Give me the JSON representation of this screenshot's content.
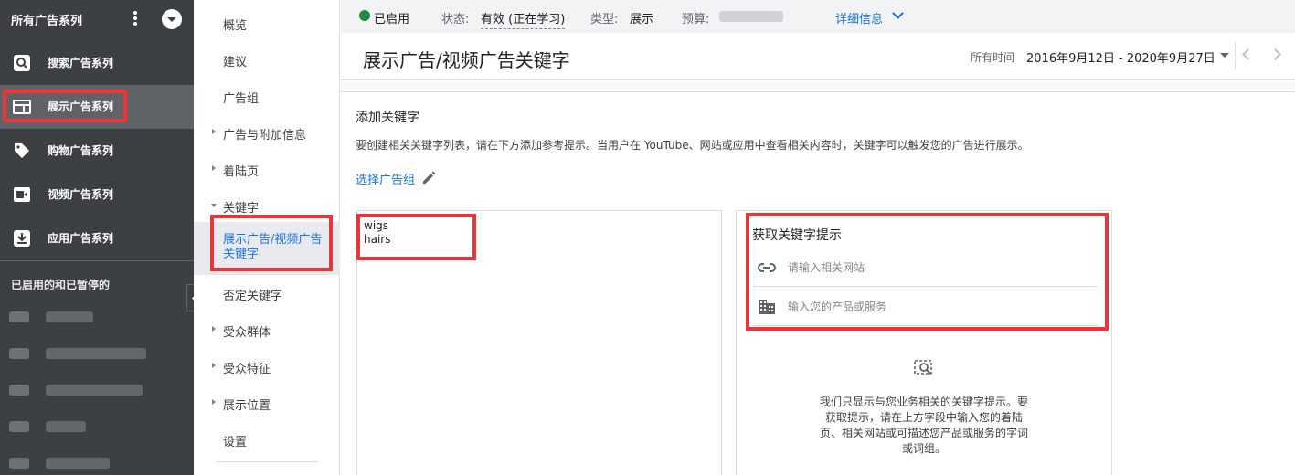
{
  "sidebar": {
    "header": "所有广告系列",
    "campaigns": [
      {
        "label": "搜索广告系列",
        "icon": "search-icon"
      },
      {
        "label": "展示广告系列",
        "icon": "display-icon"
      },
      {
        "label": "购物广告系列",
        "icon": "shopping-tag-icon"
      },
      {
        "label": "视频广告系列",
        "icon": "video-icon"
      },
      {
        "label": "应用广告系列",
        "icon": "app-download-icon"
      }
    ],
    "section_label": "已启用的和已暂停的"
  },
  "subnav": {
    "items": [
      {
        "label": "概览",
        "expandable": false
      },
      {
        "label": "建议",
        "expandable": false
      },
      {
        "label": "广告组",
        "expandable": false
      },
      {
        "label": "广告与附加信息",
        "expandable": true
      },
      {
        "label": "着陆页",
        "expandable": true
      },
      {
        "label": "关键字",
        "expandable": true
      },
      {
        "label": "展示广告/视频广告关键字",
        "expandable": false,
        "active": true
      },
      {
        "label": "否定关键字",
        "expandable": false
      },
      {
        "label": "受众群体",
        "expandable": true
      },
      {
        "label": "受众特征",
        "expandable": true
      },
      {
        "label": "展示位置",
        "expandable": true
      },
      {
        "label": "设置",
        "expandable": false
      }
    ]
  },
  "topbar": {
    "enabled": "已启用",
    "status_label": "状态:",
    "status_value": "有效 (正在学习)",
    "type_label": "类型:",
    "type_value": "展示",
    "budget_label": "预算:",
    "details": "详细信息"
  },
  "header": {
    "title": "展示广告/视频广告关键字",
    "range_label": "所有时间",
    "range_value": "2016年9月12日 - 2020年9月27日"
  },
  "main": {
    "add_title": "添加关键字",
    "description": "要创建相关关键字列表，请在下方添加参考提示。当用户在 YouTube、网站或应用中查看相关内容时，关键字可以触发您的广告进行展示。",
    "pick_group": "选择广告组",
    "keywords": [
      "wigs",
      "hairs"
    ],
    "suggest_title": "获取关键字提示",
    "url_placeholder": "请输入相关网站",
    "product_placeholder": "输入您的产品或服务",
    "info_text": "我们只显示与您业务相关的关键字提示。要获取提示，请在上方字段中输入您的着陆页、相关网站或可描述您产品或服务的字词或词组。"
  },
  "colors": {
    "sidebar_bg": "#3c4043",
    "accent": "#1a73e8",
    "highlight": "#e8363b",
    "enabled_dot": "#1e8e3e"
  }
}
